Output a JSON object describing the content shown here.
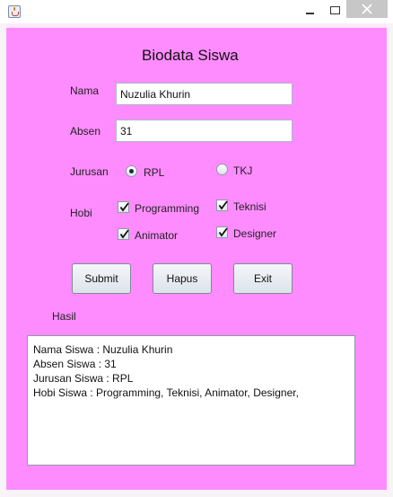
{
  "window": {
    "icon": "java-icon",
    "controls": {
      "minimize": "minimize-icon",
      "maximize": "maximize-icon",
      "close": "close-icon"
    }
  },
  "form": {
    "title": "Biodata Siswa",
    "nama_label": "Nama",
    "nama_value": "Nuzulia Khurin",
    "absen_label": "Absen",
    "absen_value": "31",
    "jurusan_label": "Jurusan",
    "jurusan_options": [
      {
        "label": "RPL",
        "selected": true
      },
      {
        "label": "TKJ",
        "selected": false
      }
    ],
    "hobi_label": "Hobi",
    "hobi_options": [
      {
        "label": "Programming",
        "checked": true
      },
      {
        "label": "Teknisi",
        "checked": true
      },
      {
        "label": "Animator",
        "checked": true
      },
      {
        "label": "Designer",
        "checked": true
      }
    ]
  },
  "buttons": {
    "submit": "Submit",
    "hapus": "Hapus",
    "exit": "Exit"
  },
  "result": {
    "label": "Hasil",
    "lines": [
      "Nama Siswa : Nuzulia Khurin",
      "Absen Siswa : 31",
      "Jurusan Siswa : RPL",
      "Hobi Siswa : Programming, Teknisi, Animator, Designer,"
    ]
  },
  "colors": {
    "panel_background": "#ff8cff",
    "frame_background": "#fde8fd",
    "close_button": "#c7c7c7"
  }
}
